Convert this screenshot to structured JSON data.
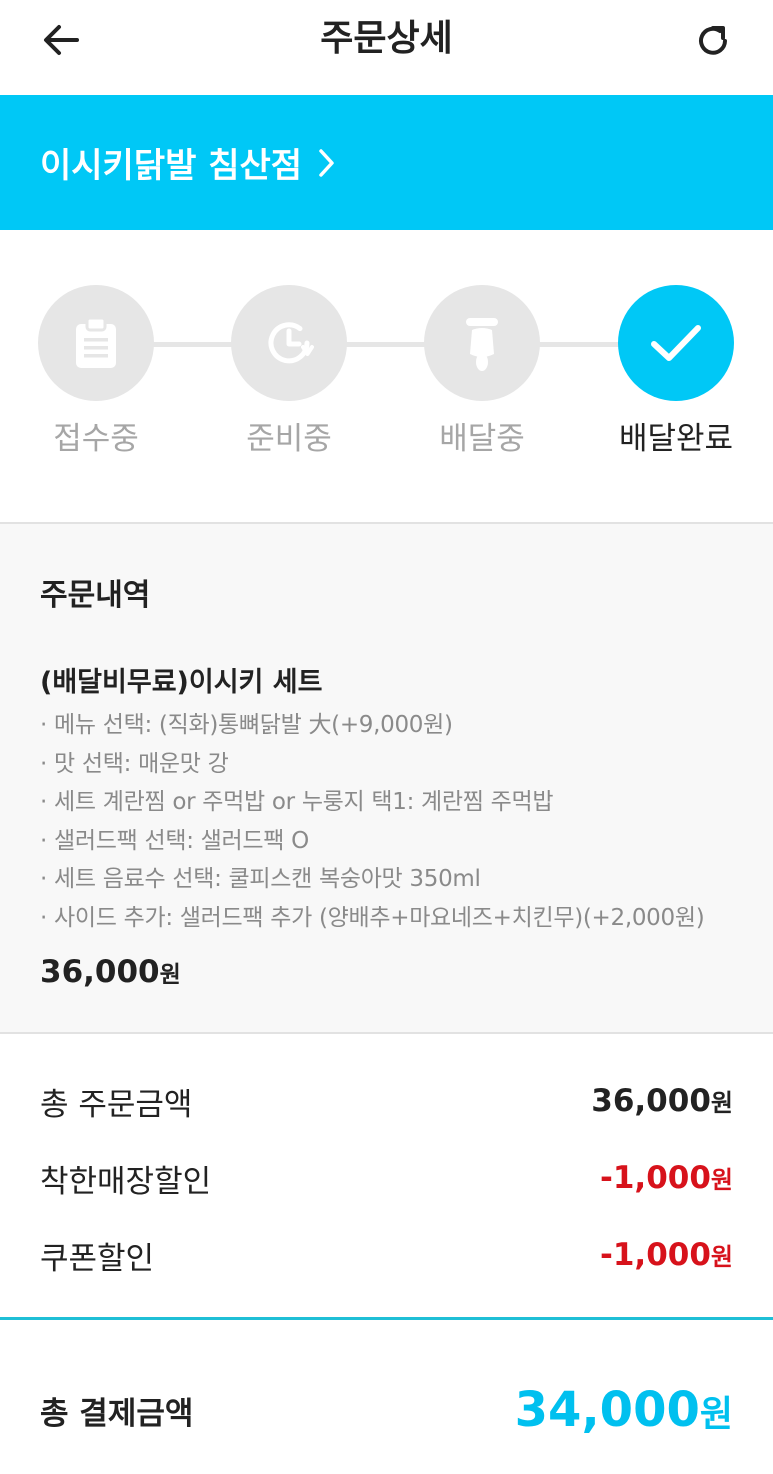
{
  "header": {
    "title": "주문상세",
    "back_icon": "arrow-left-icon",
    "refresh_icon": "refresh-icon"
  },
  "store": {
    "name": "이시키닭발 침산점",
    "banner_color": "#00c8f6"
  },
  "progress": {
    "steps": [
      {
        "label": "접수중",
        "icon": "clipboard-icon",
        "active": false
      },
      {
        "label": "준비중",
        "icon": "clock-icon",
        "active": false
      },
      {
        "label": "배달중",
        "icon": "scooter-icon",
        "active": false
      },
      {
        "label": "배달완료",
        "icon": "check-icon",
        "active": true
      }
    ]
  },
  "order": {
    "section_title": "주문내역",
    "item_name": "(배달비무료)이시키 세트",
    "options": [
      "· 메뉴 선택: (직화)통뼈닭발 大(+9,000원)",
      "· 맛 선택: 매운맛 강",
      "· 세트 계란찜 or 주먹밥 or 누룽지 택1: 계란찜 주먹밥",
      "· 샐러드팩 선택: 샐러드팩 O",
      "· 세트 음료수 선택: 쿨피스캔 복숭아맛 350ml",
      "· 사이드 추가: 샐러드팩 추가 (양배추+마요네즈+치킨무)(+2,000원)"
    ],
    "price": "36,000",
    "currency": "원"
  },
  "summary": {
    "total_order_label": "총 주문금액",
    "total_order_amount": "36,000",
    "store_discount_label": "착한매장할인",
    "store_discount_amount": "-1,000",
    "coupon_discount_label": "쿠폰할인",
    "coupon_discount_amount": "-1,000",
    "currency": "원"
  },
  "total": {
    "label": "총 결제금액",
    "amount": "34,000",
    "currency": "원",
    "color": "#00c0ef"
  }
}
